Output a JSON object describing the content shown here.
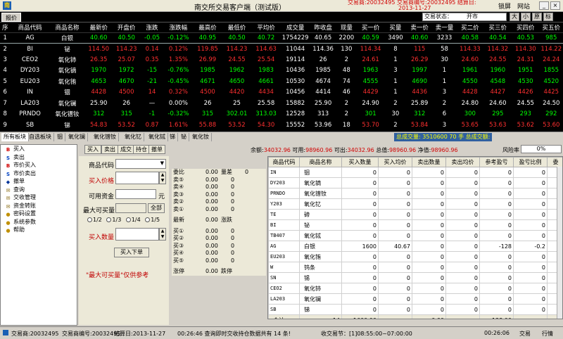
{
  "titlebar": {
    "title": "南交所交易客户端（测试版）",
    "exchange_info_1": "交易商:20032495  交易商编号:20032495  结算日:",
    "exchange_info_2": "交易商:20032495",
    "exchange_info_3": "2013-11-27",
    "lock_label": "锁屏",
    "site_label": "网站",
    "min_label": "_",
    "close_label": "×"
  },
  "quotebar": {
    "tab_label": "报价",
    "state_label": "交易状态：",
    "state_value": "开市",
    "font_buttons": [
      "大",
      "小",
      "原",
      "标"
    ]
  },
  "market": {
    "headers": [
      "序",
      "商品代码",
      "商品名称",
      "最新价",
      "开盘价",
      "涨跌",
      "涨跌幅",
      "最高价",
      "最低价",
      "平均价",
      "成交量",
      "昨收盘",
      "现量",
      "买一价",
      "买量",
      "卖一价",
      "卖一量",
      "买二价",
      "买三价",
      "买四价",
      "买五价"
    ],
    "rows": [
      {
        "i": "1",
        "code": "AG",
        "name": "白银",
        "last": "40.60",
        "open": "40.50",
        "chg": "-0.05",
        "pct": "-0.12%",
        "high": "40.95",
        "low": "40.50",
        "avg": "40.72",
        "vol": "1754229",
        "prev": "40.65",
        "cur": "2200",
        "b1": "40.59",
        "bq": "3490",
        "s1": "40.60",
        "sq": "3233",
        "b2": "40.58",
        "b3": "40.54",
        "b4": "40.53",
        "b5": "985",
        "c": "g",
        "sel": true
      },
      {
        "i": "2",
        "code": "BI",
        "name": "铋",
        "last": "114.50",
        "open": "114.23",
        "chg": "0.14",
        "pct": "0.12%",
        "high": "119.85",
        "low": "114.23",
        "avg": "114.63",
        "vol": "11044",
        "prev": "114.36",
        "cur": "130",
        "b1": "114.34",
        "bq": "8",
        "s1": "115",
        "sq": "58",
        "b2": "114.33",
        "b3": "114.32",
        "b4": "114.30",
        "b5": "114.22",
        "c": "r",
        "sel": false
      },
      {
        "i": "3",
        "code": "CEO2",
        "name": "氧化铈",
        "last": "26.35",
        "open": "25.07",
        "chg": "0.35",
        "pct": "1.35%",
        "high": "26.99",
        "low": "24.55",
        "avg": "25.54",
        "vol": "19114",
        "prev": "26",
        "cur": "2",
        "b1": "24.61",
        "bq": "1",
        "s1": "26.29",
        "sq": "30",
        "b2": "24.60",
        "b3": "24.55",
        "b4": "24.31",
        "b5": "24.24",
        "c": "r",
        "sel": false
      },
      {
        "i": "4",
        "code": "DY203",
        "name": "氧化镝",
        "last": "1970",
        "open": "1972",
        "chg": "-15",
        "pct": "-0.76%",
        "high": "1985",
        "low": "1962",
        "avg": "1983",
        "vol": "10436",
        "prev": "1985",
        "cur": "48",
        "b1": "1963",
        "bq": "3",
        "s1": "1997",
        "sq": "1",
        "b2": "1961",
        "b3": "1960",
        "b4": "1951",
        "b5": "1855",
        "c": "g",
        "sel": false
      },
      {
        "i": "5",
        "code": "EU203",
        "name": "氧化铕",
        "last": "4653",
        "open": "4670",
        "chg": "-21",
        "pct": "-0.45%",
        "high": "4671",
        "low": "4650",
        "avg": "4661",
        "vol": "10530",
        "prev": "4674",
        "cur": "74",
        "b1": "4555",
        "bq": "1",
        "s1": "4690",
        "sq": "1",
        "b2": "4550",
        "b3": "4548",
        "b4": "4530",
        "b5": "4520",
        "c": "g",
        "sel": false
      },
      {
        "i": "6",
        "code": "IN",
        "name": "铟",
        "last": "4428",
        "open": "4500",
        "chg": "14",
        "pct": "0.32%",
        "high": "4500",
        "low": "4420",
        "avg": "4434",
        "vol": "10456",
        "prev": "4414",
        "cur": "46",
        "b1": "4429",
        "bq": "1",
        "s1": "4436",
        "sq": "3",
        "b2": "4428",
        "b3": "4427",
        "b4": "4426",
        "b5": "4425",
        "c": "r",
        "sel": false
      },
      {
        "i": "7",
        "code": "LA203",
        "name": "氧化镧",
        "last": "25.90",
        "open": "26",
        "chg": "—",
        "pct": "0.00%",
        "high": "26",
        "low": "25",
        "avg": "25.58",
        "vol": "15882",
        "prev": "25.90",
        "cur": "2",
        "b1": "24.90",
        "bq": "2",
        "s1": "25.89",
        "sq": "2",
        "b2": "24.80",
        "b3": "24.60",
        "b4": "24.55",
        "b5": "24.50",
        "c": "w",
        "sel": false
      },
      {
        "i": "8",
        "code": "PRNDO",
        "name": "氧化镨钕",
        "last": "312",
        "open": "315",
        "chg": "-1",
        "pct": "-0.32%",
        "high": "315",
        "low": "302.01",
        "avg": "313.03",
        "vol": "12528",
        "prev": "313",
        "cur": "2",
        "b1": "301",
        "bq": "30",
        "s1": "312",
        "sq": "6",
        "b2": "300",
        "b3": "295",
        "b4": "293",
        "b5": "292",
        "c": "g",
        "sel": false
      },
      {
        "i": "9",
        "code": "SB",
        "name": "锑",
        "last": "54.83",
        "open": "53.52",
        "chg": "0.87",
        "pct": "1.61%",
        "high": "55.88",
        "low": "53.52",
        "avg": "54.30",
        "vol": "15552",
        "prev": "53.96",
        "cur": "18",
        "b1": "53.70",
        "bq": "2",
        "s1": "53.84",
        "sq": "3",
        "b2": "53.65",
        "b3": "53.63",
        "b4": "53.62",
        "b5": "53.60",
        "c": "r",
        "sel": false
      }
    ]
  },
  "boardbar": {
    "tabs": [
      "所有板块",
      "自选板块",
      "铟",
      "氧化镧",
      "氧化镨钕",
      "氧化钇",
      "氧化铽",
      "锑",
      "铋",
      "氧化钕"
    ],
    "info": "总成交量: 3510600 70 手     总成交额:"
  },
  "nav": {
    "items": [
      {
        "label": "买入",
        "icon": "B",
        "color": "#d00000"
      },
      {
        "label": "卖出",
        "icon": "S",
        "color": "#0040c0"
      },
      {
        "label": "市价买入",
        "icon": "B",
        "color": "#d00000"
      },
      {
        "label": "市价卖出",
        "icon": "S",
        "color": "#0040c0"
      },
      {
        "label": "撤单",
        "icon": "◆",
        "color": "#003399"
      },
      {
        "label": "查询",
        "icon": "✉",
        "color": "#806000"
      },
      {
        "label": "交收管理",
        "icon": "✉",
        "color": "#806000"
      },
      {
        "label": "资金转账",
        "icon": "✉",
        "color": "#806000"
      },
      {
        "label": "密码设置",
        "icon": "●",
        "color": "#c09000"
      },
      {
        "label": "系统参数",
        "icon": "●",
        "color": "#c09000"
      },
      {
        "label": "帮助",
        "icon": "●",
        "color": "#c09000"
      }
    ]
  },
  "toolbar": {
    "buttons": [
      "买入",
      "卖出",
      "成交",
      "持仓",
      "撤单"
    ],
    "acct_prefix_1": "余额:",
    "balance": "34032.96",
    "acct_prefix_2": " 可用:",
    "available": "98960.96",
    "acct_prefix_3": " 可出:",
    "withdrawable": "34032.96",
    "acct_prefix_4": " 总值:",
    "total_value": "98960.96",
    "acct_prefix_5": " 净值:",
    "net_value": "98960.96",
    "risk_label": "风险率",
    "risk_value": "0%"
  },
  "order": {
    "code_label": "商品代码",
    "price_label": "买入价格",
    "funds_label": "可用资金",
    "funds_unit": "元",
    "max_label": "最大可买量",
    "all_button": "全部",
    "radios": [
      "1/2",
      "1/3",
      "1/4",
      "1/5"
    ],
    "qty_label": "买入数量",
    "submit_button": "买入下单",
    "note": "\"最大可买量\"仅供参考"
  },
  "depth": {
    "weibi_label": "委比",
    "weibi_val": "0.00",
    "weicha_label": "量差",
    "weicha_val": "0",
    "sells": [
      {
        "l": "卖⑤",
        "p": "0.00",
        "v": "0"
      },
      {
        "l": "卖④",
        "p": "0.00",
        "v": "0"
      },
      {
        "l": "卖③",
        "p": "0.00",
        "v": "0"
      },
      {
        "l": "卖②",
        "p": "0.00",
        "v": "0"
      },
      {
        "l": "卖①",
        "p": "0.00",
        "v": "0"
      }
    ],
    "last_label": "最新",
    "last_val": "0.00",
    "zhangdie_label": "涨跌",
    "zhangdie_val": "",
    "buys": [
      {
        "l": "买①",
        "p": "0.00",
        "v": "0"
      },
      {
        "l": "买②",
        "p": "0.00",
        "v": "0"
      },
      {
        "l": "买③",
        "p": "0.00",
        "v": "0"
      },
      {
        "l": "买④",
        "p": "0.00",
        "v": "0"
      },
      {
        "l": "买⑤",
        "p": "0.00",
        "v": "0"
      }
    ],
    "zhangting_label": "涨停",
    "zhangting_val": "0.00",
    "dieting_label": "跌停",
    "dieting_val": "0.00"
  },
  "holdings": {
    "headers": [
      "商品代码",
      "商品名称",
      "买入数量",
      "买入均价",
      "卖出数量",
      "卖出均价",
      "参考盈亏",
      "盈亏比例",
      "委"
    ],
    "rows": [
      {
        "code": "IN",
        "name": "铟",
        "bq": "0",
        "bp": "0",
        "sq": "0",
        "sp": "0",
        "pl": "0",
        "pr": "0"
      },
      {
        "code": "DY203",
        "name": "氧化镝",
        "bq": "0",
        "bp": "0",
        "sq": "0",
        "sp": "0",
        "pl": "0",
        "pr": "0"
      },
      {
        "code": "PRNDO",
        "name": "氧化镨钕",
        "bq": "0",
        "bp": "0",
        "sq": "0",
        "sp": "0",
        "pl": "0",
        "pr": "0"
      },
      {
        "code": "Y203",
        "name": "氧化钇",
        "bq": "0",
        "bp": "0",
        "sq": "0",
        "sp": "0",
        "pl": "0",
        "pr": "0"
      },
      {
        "code": "TE",
        "name": "碲",
        "bq": "0",
        "bp": "0",
        "sq": "0",
        "sp": "0",
        "pl": "0",
        "pr": "0"
      },
      {
        "code": "BI",
        "name": "铋",
        "bq": "0",
        "bp": "0",
        "sq": "0",
        "sp": "0",
        "pl": "0",
        "pr": "0"
      },
      {
        "code": "TB407",
        "name": "氧化铽",
        "bq": "0",
        "bp": "0",
        "sq": "0",
        "sp": "0",
        "pl": "0",
        "pr": "0"
      },
      {
        "code": "AG",
        "name": "白银",
        "bq": "1600",
        "bp": "40.67",
        "sq": "0",
        "sp": "0",
        "pl": "-128",
        "pr": "-0.2"
      },
      {
        "code": "EU203",
        "name": "氧化铕",
        "bq": "0",
        "bp": "0",
        "sq": "0",
        "sp": "0",
        "pl": "0",
        "pr": "0"
      },
      {
        "code": "W",
        "name": "钨条",
        "bq": "0",
        "bp": "0",
        "sq": "0",
        "sp": "0",
        "pl": "0",
        "pr": "0"
      },
      {
        "code": "SN",
        "name": "锡",
        "bq": "0",
        "bp": "0",
        "sq": "0",
        "sp": "0",
        "pl": "0",
        "pr": "0"
      },
      {
        "code": "CEO2",
        "name": "氧化铈",
        "bq": "0",
        "bp": "0",
        "sq": "0",
        "sp": "0",
        "pl": "0",
        "pr": "0"
      },
      {
        "code": "LA203",
        "name": "氧化镧",
        "bq": "0",
        "bp": "0",
        "sq": "0",
        "sp": "0",
        "pl": "0",
        "pr": "0"
      },
      {
        "code": "SB",
        "name": "锑",
        "bq": "0",
        "bp": "0",
        "sq": "0",
        "sp": "0",
        "pl": "0",
        "pr": "0"
      }
    ],
    "total": {
      "label": "合计",
      "count": "14",
      "bq": "1600.00",
      "sq": "0.00",
      "pl": "-128.00"
    }
  },
  "status": {
    "trader": "交易商:20032495",
    "trader_no": "交易商编号:20032495",
    "settle": "结算日:2013-11-27",
    "msg": "00:26:46  查询即时交收持仓数据共有 14 条!",
    "section": "收交易节：[1]08:55:00~07:00:00",
    "time": "00:26:06",
    "trade_label": "交易",
    "quote_label": "行情"
  }
}
